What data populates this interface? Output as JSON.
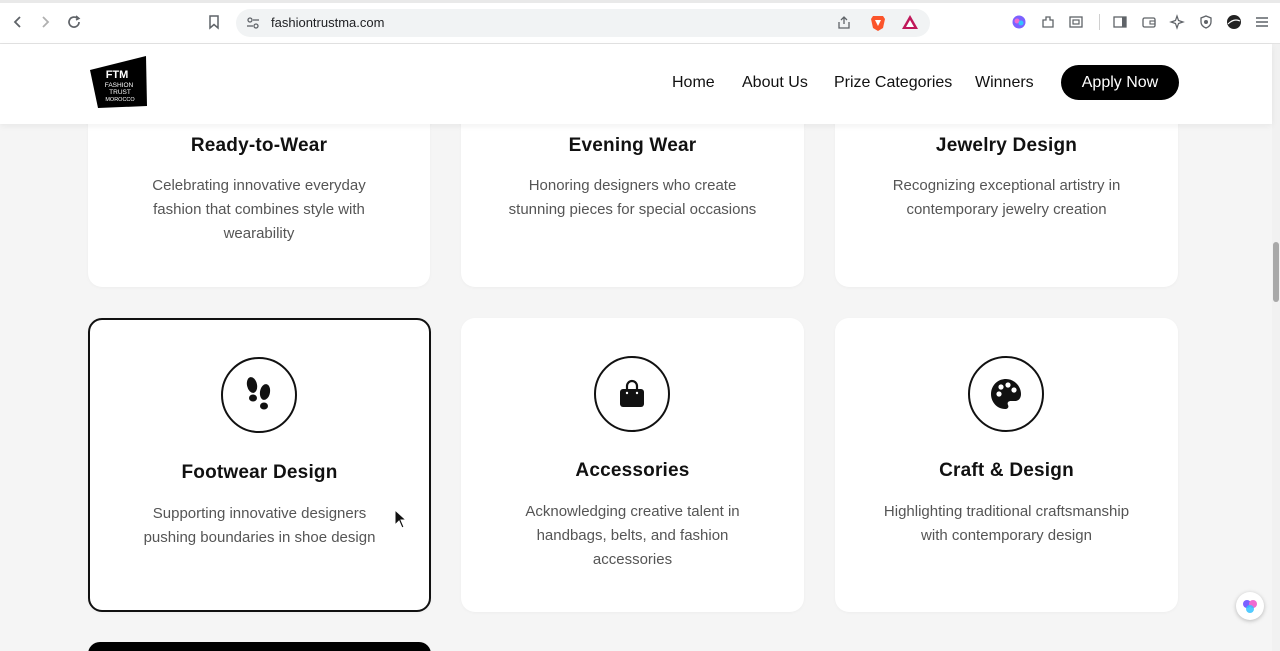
{
  "browser": {
    "url": "fashiontrustma.com"
  },
  "header": {
    "logo": {
      "abbr": "FTM",
      "line1": "FASHION",
      "line2": "TRUST",
      "line3": "MOROCCO"
    },
    "nav": [
      "Home",
      "About Us",
      "Prize Categories",
      "Winners"
    ],
    "cta": "Apply Now"
  },
  "categories": [
    {
      "title": "Ready-to-Wear",
      "desc": [
        "Celebrating innovative everyday",
        "fashion that combines style with",
        "wearability"
      ],
      "icon": "shirt-icon"
    },
    {
      "title": "Evening Wear",
      "desc": [
        "Honoring designers who create",
        "stunning pieces for special occasions"
      ],
      "icon": "gown-icon"
    },
    {
      "title": "Jewelry Design",
      "desc": [
        "Recognizing exceptional artistry in",
        "contemporary jewelry creation"
      ],
      "icon": "gem-icon"
    },
    {
      "title": "Footwear Design",
      "desc": [
        "Supporting innovative designers",
        "pushing boundaries in shoe design"
      ],
      "icon": "shoe-prints-icon"
    },
    {
      "title": "Accessories",
      "desc": [
        "Acknowledging creative talent in",
        "handbags, belts, and fashion",
        "accessories"
      ],
      "icon": "shopping-bag-icon"
    },
    {
      "title": "Craft & Design",
      "desc": [
        "Highlighting traditional craftsmanship",
        "with contemporary design"
      ],
      "icon": "palette-icon"
    }
  ],
  "colors": {
    "accent": "#000000",
    "card_bg": "#ffffff",
    "page_bg": "#f5f5f5",
    "desc_text": "#555555"
  }
}
